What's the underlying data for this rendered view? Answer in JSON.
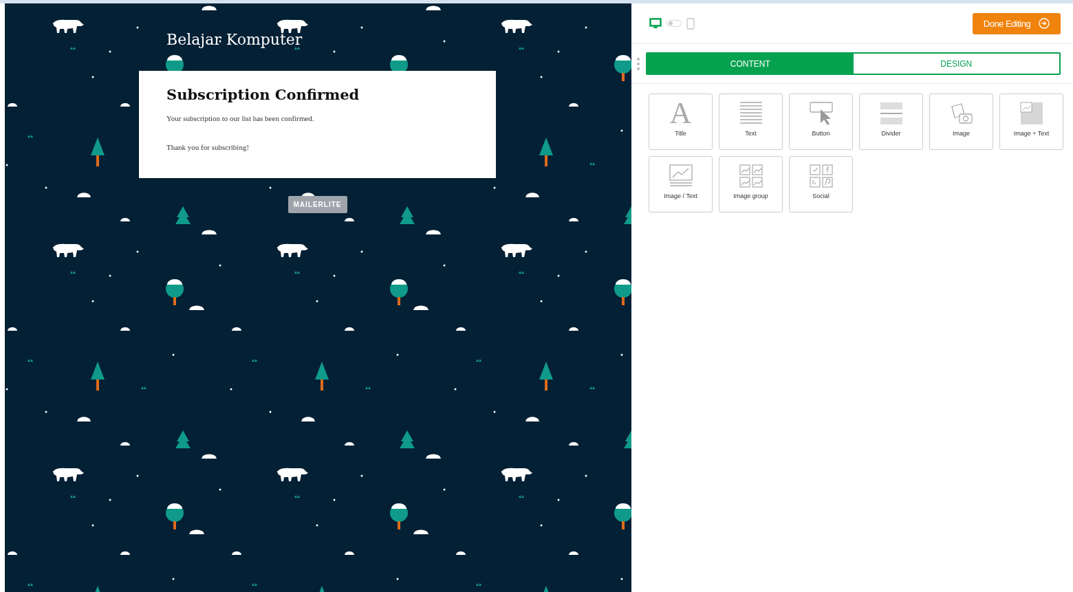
{
  "preview": {
    "site_title": "Belajar Komputer",
    "heading": "Subscription Confirmed",
    "paragraphs": [
      "Your subscription to our list has been confirmed.",
      "Thank you for subscribing!"
    ],
    "badge": "MAILERLITE"
  },
  "toolbar": {
    "devices": [
      {
        "kind": "desktop",
        "selected": true
      },
      {
        "kind": "mobile",
        "selected": false
      }
    ],
    "done_button": "Done Editing"
  },
  "tabs": [
    {
      "label": "CONTENT",
      "selected": true
    },
    {
      "label": "DESIGN",
      "selected": false
    }
  ],
  "blocks": [
    {
      "kind": "title",
      "label": "Title",
      "glyph": "A"
    },
    {
      "kind": "text",
      "label": "Text"
    },
    {
      "kind": "button",
      "label": "Button"
    },
    {
      "kind": "divider",
      "label": "Divider"
    },
    {
      "kind": "image",
      "label": "Image"
    },
    {
      "kind": "image_text",
      "label": "Image + Text"
    },
    {
      "kind": "image_over_text",
      "label": "Image / Text"
    },
    {
      "kind": "image_group",
      "label": "Image group"
    },
    {
      "kind": "social",
      "label": "Social"
    }
  ]
}
